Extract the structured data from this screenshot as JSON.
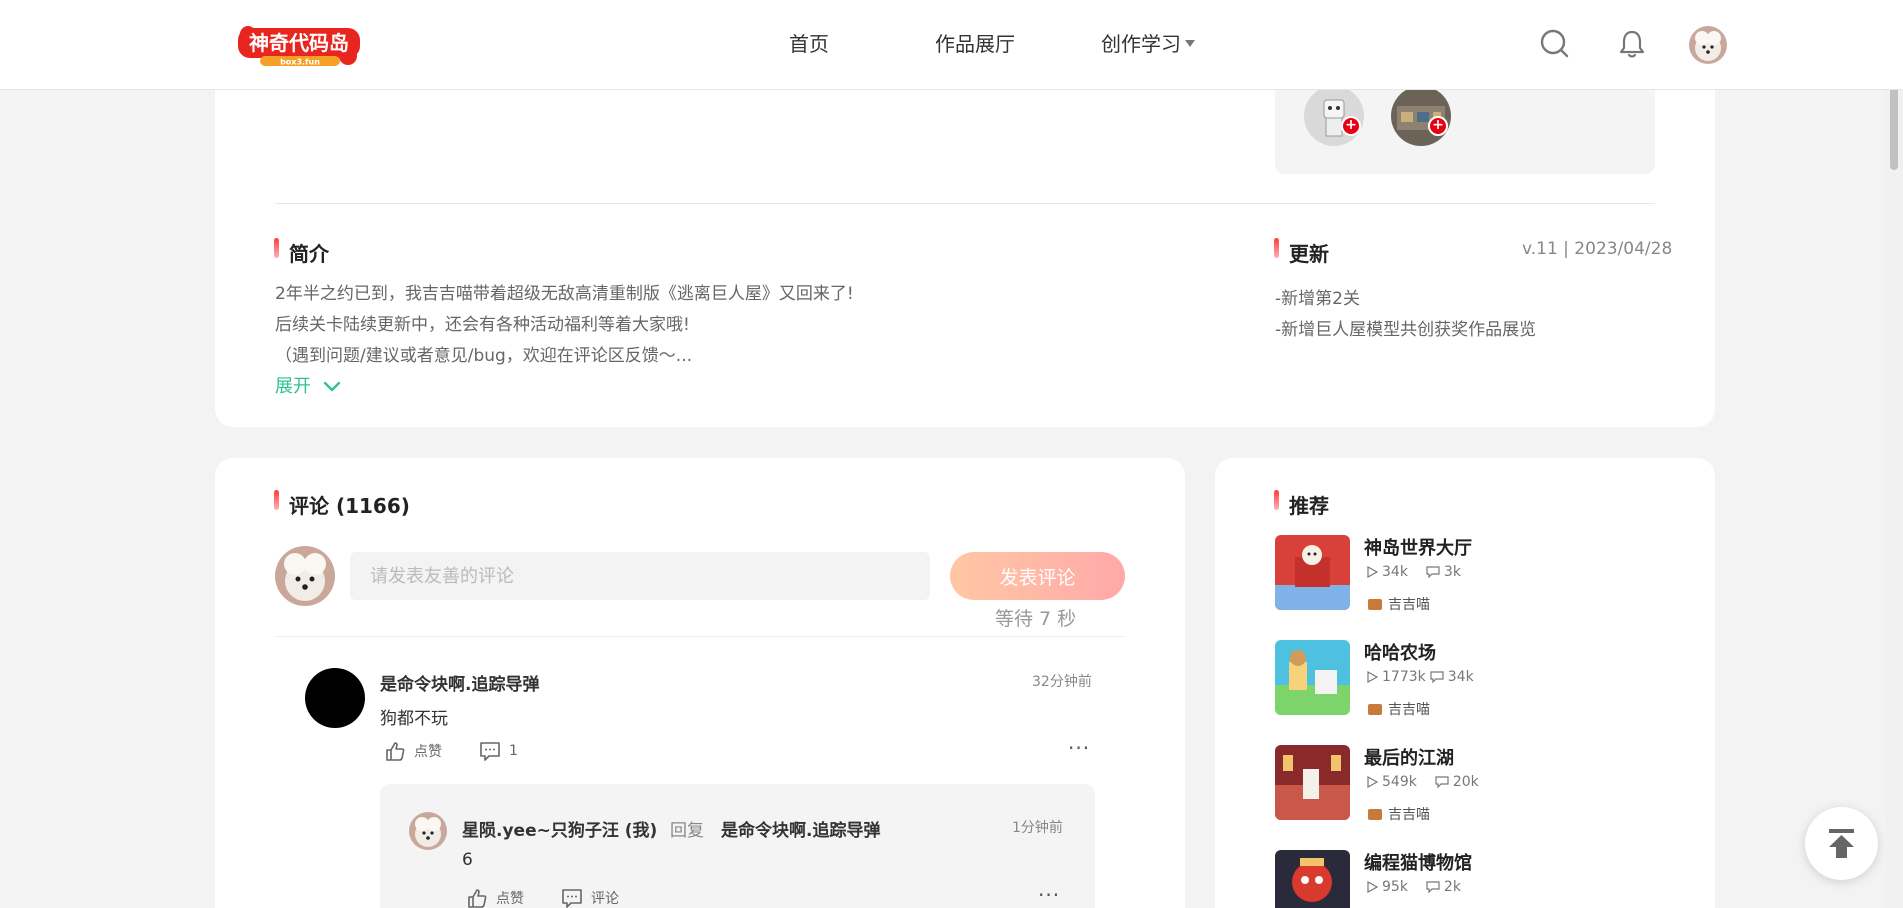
{
  "nav": {
    "logo_text": "神奇代码岛",
    "logo_sub": "box3.fun",
    "home": "首页",
    "gallery": "作品展厅",
    "learn": "创作学习"
  },
  "intro": {
    "title": "简介",
    "lines": [
      "2年半之约已到，我吉吉喵带着超级无敌高清重制版《逃离巨人屋》又回来了!",
      "后续关卡陆续更新中，还会有各种活动福利等着大家哦!",
      "（遇到问题/建议或者意见/bug，欢迎在评论区反馈～..."
    ],
    "expand": "展开"
  },
  "update": {
    "title": "更新",
    "version": "v.11 | 2023/04/28",
    "lines": [
      "-新增第2关",
      "-新增巨人屋模型共创获奖作品展览"
    ]
  },
  "comments": {
    "title": "评论 (1166)",
    "placeholder": "请发表友善的评论",
    "post_button": "发表评论",
    "wait": "等待 7 秒",
    "items": [
      {
        "user": "是命令块啊.追踪导弹",
        "time": "32分钟前",
        "text": "狗都不玩",
        "like_label": "点赞",
        "reply_count": "1",
        "more": "···"
      }
    ],
    "reply": {
      "user": "星陨.yee~只狗子汪 (我)",
      "reply_word": "回复",
      "target": "是命令块啊.追踪导弹",
      "time": "1分钟前",
      "text": "6",
      "like_label": "点赞",
      "comment_label": "评论",
      "more": "···"
    }
  },
  "recommend": {
    "title": "推荐",
    "items": [
      {
        "title": "神岛世界大厅",
        "plays": "34k",
        "comments": "3k",
        "author": "吉吉喵"
      },
      {
        "title": "哈哈农场",
        "plays": "1773k",
        "comments": "34k",
        "author": "吉吉喵"
      },
      {
        "title": "最后的江湖",
        "plays": "549k",
        "comments": "20k",
        "author": "吉吉喵"
      },
      {
        "title": "编程猫博物馆",
        "plays": "95k",
        "comments": "2k",
        "author": ""
      }
    ]
  },
  "icons": {
    "search": "search-icon",
    "bell": "bell-icon",
    "play": "play-icon",
    "comment": "comment-icon",
    "like": "thumbs-up-icon",
    "back_top": "back-to-top-icon"
  },
  "colors": {
    "accent_green": "#2fc38e",
    "accent_red": "#e60012",
    "post_gradient_start": "#ffc7a4",
    "post_gradient_end": "#ffa9a9"
  }
}
